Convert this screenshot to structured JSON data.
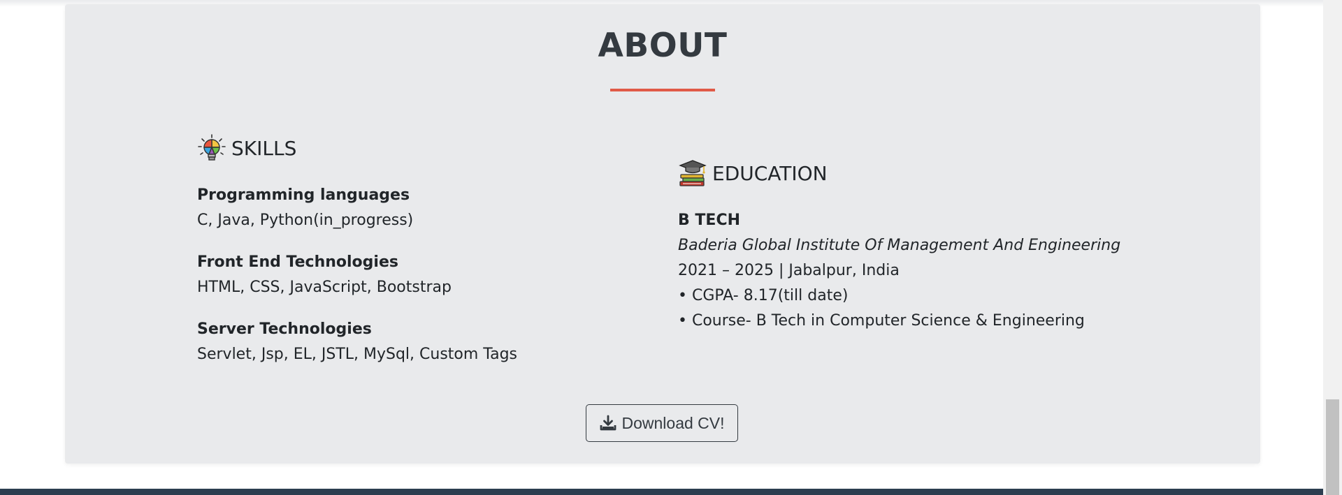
{
  "about": {
    "title": "ABOUT"
  },
  "skills": {
    "heading": "SKILLS",
    "icon": "lightbulb-icon",
    "items": [
      {
        "label": "Programming languages",
        "value": "C, Java, Python(in_progress)"
      },
      {
        "label": "Front End Technologies",
        "value": "HTML, CSS, JavaScript, Bootstrap"
      },
      {
        "label": "Server Technologies",
        "value": "Servlet, Jsp, EL, JSTL, MySql, Custom Tags"
      }
    ]
  },
  "education": {
    "heading": "EDUCATION",
    "icon": "graduation-books-icon",
    "degree": "B TECH",
    "institute": "Baderia Global Institute Of Management And Engineering",
    "period_location": "2021 – 2025 | Jabalpur, India",
    "cgpa": "• CGPA- 8.17(till date)",
    "course": "• Course- B Tech in Computer Science & Engineering"
  },
  "download": {
    "label": "Download CV!",
    "icon": "download-icon"
  },
  "colors": {
    "card_bg": "#e9eaec",
    "accent": "#e05a47",
    "title": "#343a40",
    "footer": "#2c3e50"
  }
}
